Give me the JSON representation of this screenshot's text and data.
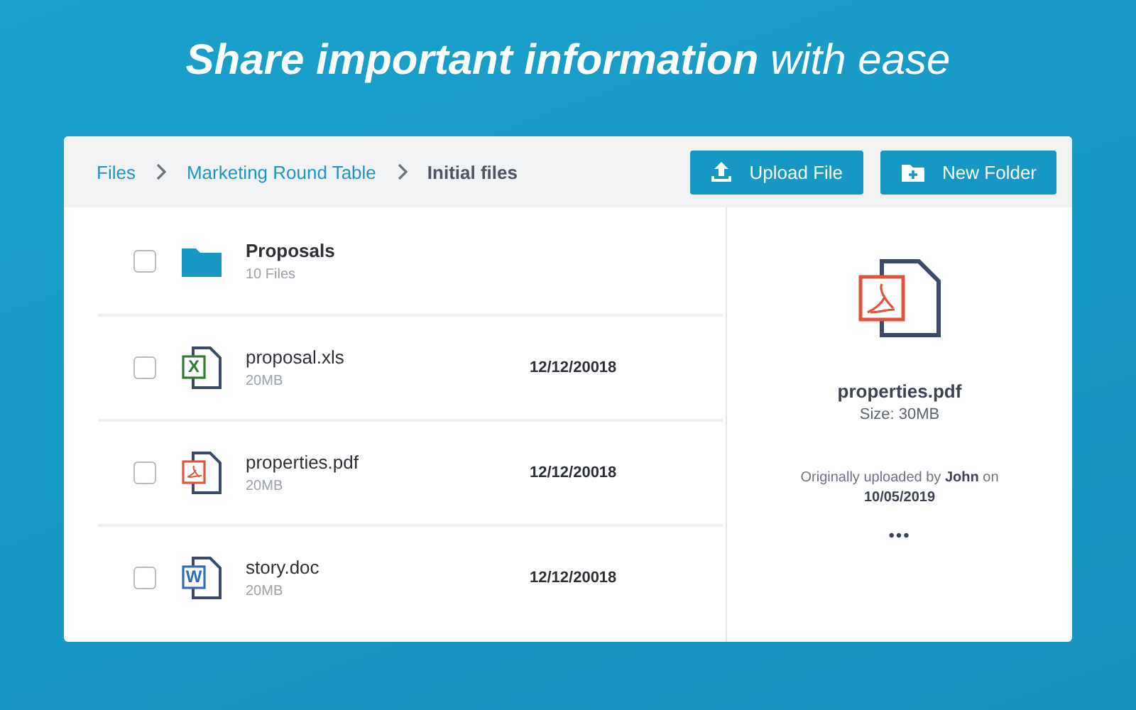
{
  "headline": "**Share important information** with ease",
  "breadcrumb": [
    {
      "label": "Files",
      "current": false
    },
    {
      "label": "Marketing Round Table",
      "current": false
    },
    {
      "label": "Initial files",
      "current": true
    }
  ],
  "buttons": [
    {
      "kind": "upload",
      "label": "Upload File"
    },
    {
      "kind": "folder",
      "label": "New Folder"
    }
  ],
  "items": [
    {
      "kind": "folder",
      "name": "Proposals",
      "meta": "10 Files",
      "checked": false
    },
    {
      "kind": "xls",
      "icon_letter": "X",
      "name": "proposal.xls",
      "meta": "20MB",
      "date": "12/12/20018",
      "checked": false
    },
    {
      "kind": "pdf",
      "name": "properties.pdf",
      "meta": "20MB",
      "date": "12/12/20018",
      "checked": false
    },
    {
      "kind": "doc",
      "icon_letter": "W",
      "name": "story.doc",
      "meta": "20MB",
      "date": "12/12/20018",
      "checked": false
    }
  ],
  "details": {
    "kind": "pdf",
    "name": "properties.pdf",
    "size": "Size: 30MB",
    "uploaded": "Originally uploaded by **John** on **10/05/2019**",
    "more": "•••"
  }
}
